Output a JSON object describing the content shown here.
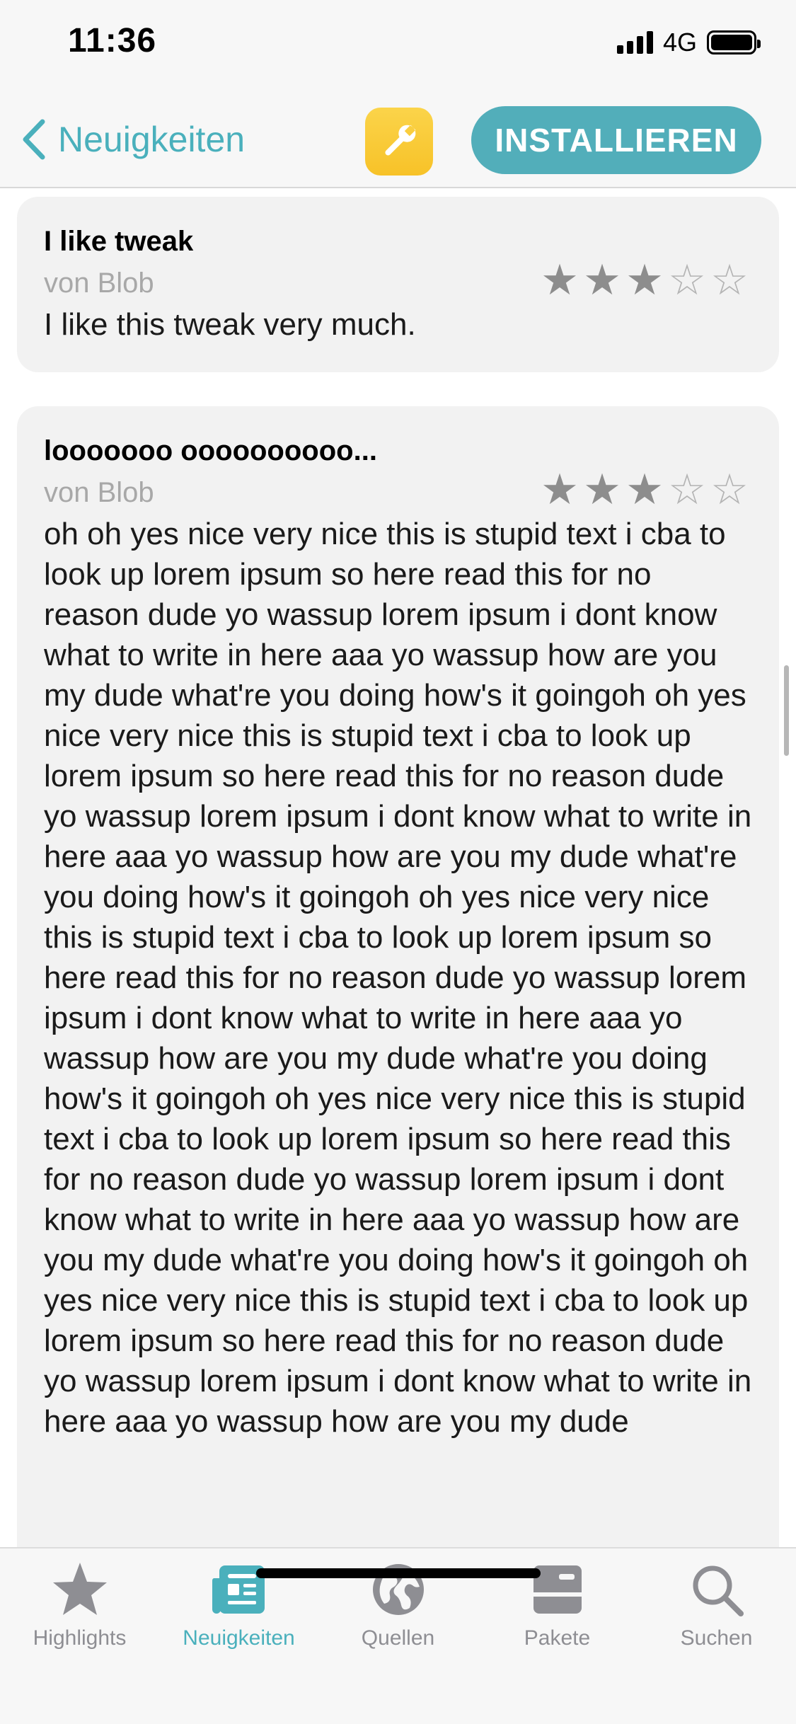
{
  "status_bar": {
    "time": "11:36",
    "network": "4G",
    "icons": [
      "signal-bars-icon",
      "battery-icon"
    ]
  },
  "nav": {
    "back_label": "Neuigkeiten",
    "back_icon": "chevron-left-icon",
    "app_icon": "wrench-icon",
    "install_label": "INSTALLIEREN",
    "accent_color": "#4ab0bc",
    "install_color": "#52aeba",
    "app_icon_color": "#f8c83a"
  },
  "reviews": [
    {
      "title": "I like tweak",
      "author": "von Blob",
      "rating": 3,
      "max_rating": 5,
      "body": "I like this tweak very much."
    },
    {
      "title": "looooooo oooooooooo...",
      "author": "von Blob",
      "rating": 3,
      "max_rating": 5,
      "body": "oh oh yes nice very nice this is stupid text i cba to look up lorem ipsum so here read this for no reason dude yo wassup lorem ipsum i dont know what to write in here aaa yo wassup how are you my dude what're you doing how's it goingoh oh yes nice very nice this is stupid text i cba to look up lorem ipsum so here read this for no reason dude yo wassup lorem ipsum i dont know what to write in here aaa yo wassup how are you my dude what're you doing how's it goingoh oh yes nice very nice this is stupid text i cba to look up lorem ipsum so here read this for no reason dude yo wassup lorem ipsum i dont know what to write in here aaa yo wassup how are you my dude what're you doing how's it goingoh oh yes nice very nice this is stupid text i cba to look up lorem ipsum so here read this for no reason dude yo wassup lorem ipsum i dont know what to write in here aaa yo wassup how are you my dude what're you doing how's it goingoh oh yes nice very nice this is stupid text i cba to look up lorem ipsum so here read this for no reason dude yo wassup lorem ipsum i dont know what to write in here aaa yo wassup how are you my dude"
    }
  ],
  "tab_bar": {
    "tabs": [
      {
        "label": "Highlights",
        "icon": "star-icon",
        "active": false
      },
      {
        "label": "Neuigkeiten",
        "icon": "newspaper-icon",
        "active": true
      },
      {
        "label": "Quellen",
        "icon": "globe-icon",
        "active": false
      },
      {
        "label": "Pakete",
        "icon": "package-icon",
        "active": false
      },
      {
        "label": "Suchen",
        "icon": "search-icon",
        "active": false
      }
    ]
  }
}
